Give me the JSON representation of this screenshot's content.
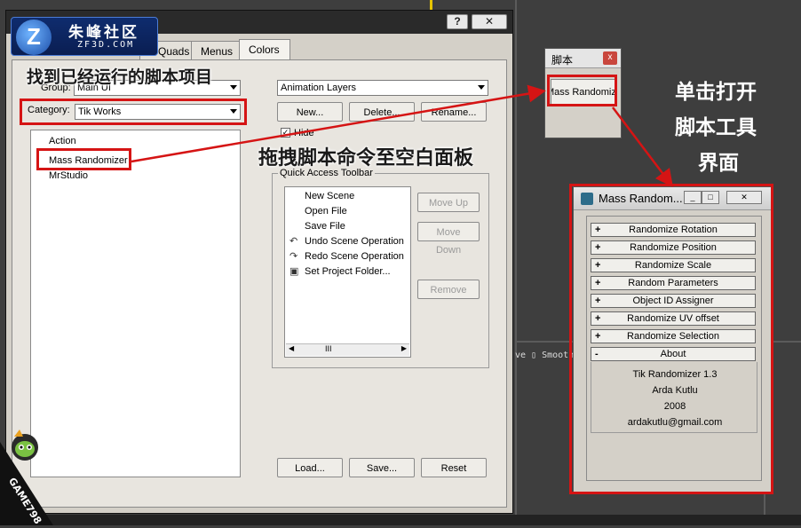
{
  "main_dialog": {
    "title_buttons": {
      "help": "?",
      "close": "✕"
    },
    "tabs": [
      {
        "label": "Quads"
      },
      {
        "label": "Menus"
      },
      {
        "label": "Colors"
      }
    ],
    "group_label": "Group:",
    "group_value": "Main UI",
    "category_label": "Category:",
    "category_value": "Tik Works",
    "action_list": [
      "Action",
      "Mass Randomizer",
      "MrStudio"
    ],
    "toolbar_select": "Animation Layers",
    "new_button": "New...",
    "delete_button": "Delete...",
    "rename_button": "Rename...",
    "hide_label": "Hide",
    "quick_access_title": "Quick Access Toolbar",
    "quick_access_items": [
      "New Scene",
      "Open File",
      "Save File",
      "Undo Scene Operation",
      "Redo Scene Operation",
      "Set Project Folder..."
    ],
    "scroll_thumb": "III",
    "move_up_button": "Move Up",
    "move_down_button": "Move Down",
    "remove_button": "Remove",
    "load_button": "Load...",
    "save_button": "Save...",
    "reset_button": "Reset"
  },
  "logo": {
    "mark": "Z",
    "cn_text": "朱峰社区",
    "en_text": "ZF3D.COM"
  },
  "annotations": {
    "find_script": "找到已经运行的脚本项目",
    "drag_command": "拖拽脚本命令至空白面板",
    "click_open_line1": "单击打开",
    "click_open_line2": "脚本工具",
    "click_open_line3": "界面"
  },
  "script_window": {
    "title": "脚本",
    "close": "x",
    "button_label": "Mass Randomizer"
  },
  "mass_randomizer": {
    "title": "Mass Random...",
    "rollouts": [
      {
        "sign": "+",
        "label": "Randomize Rotation"
      },
      {
        "sign": "+",
        "label": "Randomize Position"
      },
      {
        "sign": "+",
        "label": "Randomize Scale"
      },
      {
        "sign": "+",
        "label": "Random Parameters"
      },
      {
        "sign": "+",
        "label": "Object ID Assigner"
      },
      {
        "sign": "+",
        "label": "Randomize UV offset"
      },
      {
        "sign": "+",
        "label": "Randomize Selection"
      },
      {
        "sign": "-",
        "label": "About"
      }
    ],
    "about_lines": [
      "Tik Randomizer 1.3",
      "Arda Kutlu",
      "2008",
      "ardakutlu@gmail.com"
    ]
  },
  "viewport_label": "ve ▯ Smooth",
  "watermark": {
    "name": "GAME798"
  },
  "colors": {
    "annotation_red": "#d51414",
    "dialog_bg": "#d4d0c8"
  }
}
